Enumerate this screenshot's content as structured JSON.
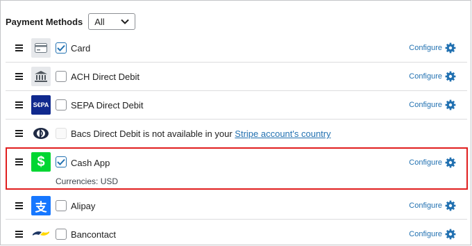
{
  "header": {
    "label": "Payment Methods",
    "filter_value": "All"
  },
  "configure_label": "Configure",
  "methods": [
    {
      "name": "Card",
      "checked": true,
      "icon": "credit-card-icon"
    },
    {
      "name": "ACH Direct Debit",
      "checked": false,
      "icon": "bank-icon"
    },
    {
      "name": "SEPA Direct Debit",
      "checked": false,
      "icon": "sepa-icon",
      "logo_text": "S€PA"
    },
    {
      "name_prefix": "Bacs Direct Debit is not available in your ",
      "link": "Stripe account's country",
      "disabled": true,
      "icon": "bacs-icon"
    },
    {
      "name": "Cash App",
      "checked": true,
      "icon": "cash-app-icon",
      "logo_text": "$",
      "currencies": "Currencies: USD",
      "highlighted": true
    },
    {
      "name": "Alipay",
      "checked": false,
      "icon": "alipay-icon",
      "logo_text": "支"
    },
    {
      "name": "Bancontact",
      "checked": false,
      "icon": "bancontact-icon"
    }
  ],
  "colors": {
    "accent": "#2271b1",
    "highlight": "#e01e1e",
    "cash_app": "#00d632",
    "alipay": "#1677ff",
    "sepa": "#10298e"
  }
}
